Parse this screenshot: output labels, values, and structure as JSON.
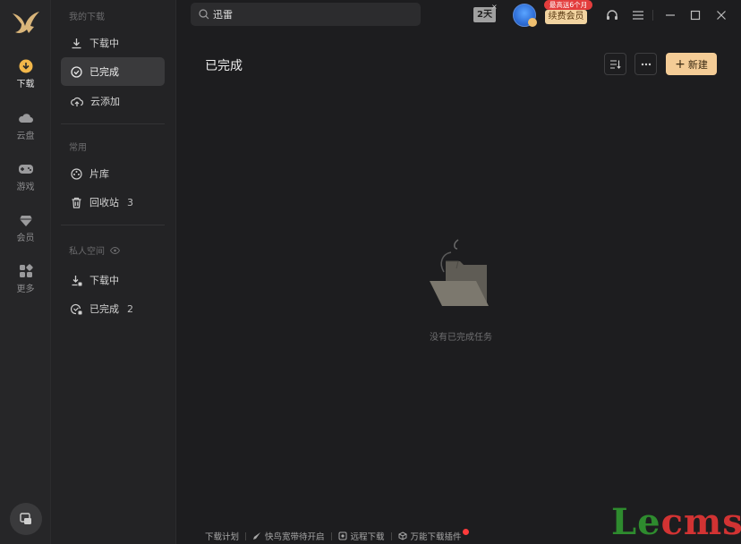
{
  "search": {
    "value": "迅雷"
  },
  "top": {
    "days_badge": "2天",
    "promo_tag": "最高送6个月",
    "renew_label": "续费会员"
  },
  "rail": [
    {
      "label": "下载",
      "icon": "download-icon"
    },
    {
      "label": "云盘",
      "icon": "cloud-icon"
    },
    {
      "label": "游戏",
      "icon": "gamepad-icon"
    },
    {
      "label": "会员",
      "icon": "diamond-icon"
    },
    {
      "label": "更多",
      "icon": "apps-icon"
    }
  ],
  "sidebar": {
    "section_my": "我的下载",
    "items_my": [
      {
        "label": "下载中",
        "icon": "download-arrow-icon"
      },
      {
        "label": "已完成",
        "icon": "check-circle-icon"
      },
      {
        "label": "云添加",
        "icon": "cloud-upload-icon"
      }
    ],
    "section_common": "常用",
    "items_common": [
      {
        "label": "片库",
        "icon": "film-reel-icon",
        "count": ""
      },
      {
        "label": "回收站",
        "icon": "trash-icon",
        "count": "3"
      }
    ],
    "section_private": "私人空间",
    "items_private": [
      {
        "label": "下载中",
        "icon": "private-download-icon",
        "count": ""
      },
      {
        "label": "已完成",
        "icon": "private-complete-icon",
        "count": "2"
      }
    ]
  },
  "main": {
    "title": "已完成",
    "new_label": "新建",
    "empty_text": "没有已完成任务"
  },
  "footer": {
    "plan": "下载计划",
    "boost": "快鸟宽带待开启",
    "remote": "远程下载",
    "plugin": "万能下载插件"
  },
  "watermark": {
    "part1": "Le",
    "part2": "cms"
  },
  "colors": {
    "accent": "#f4cc96",
    "active_bg": "#3a3a3c",
    "promo_red": "#e33d3d"
  }
}
